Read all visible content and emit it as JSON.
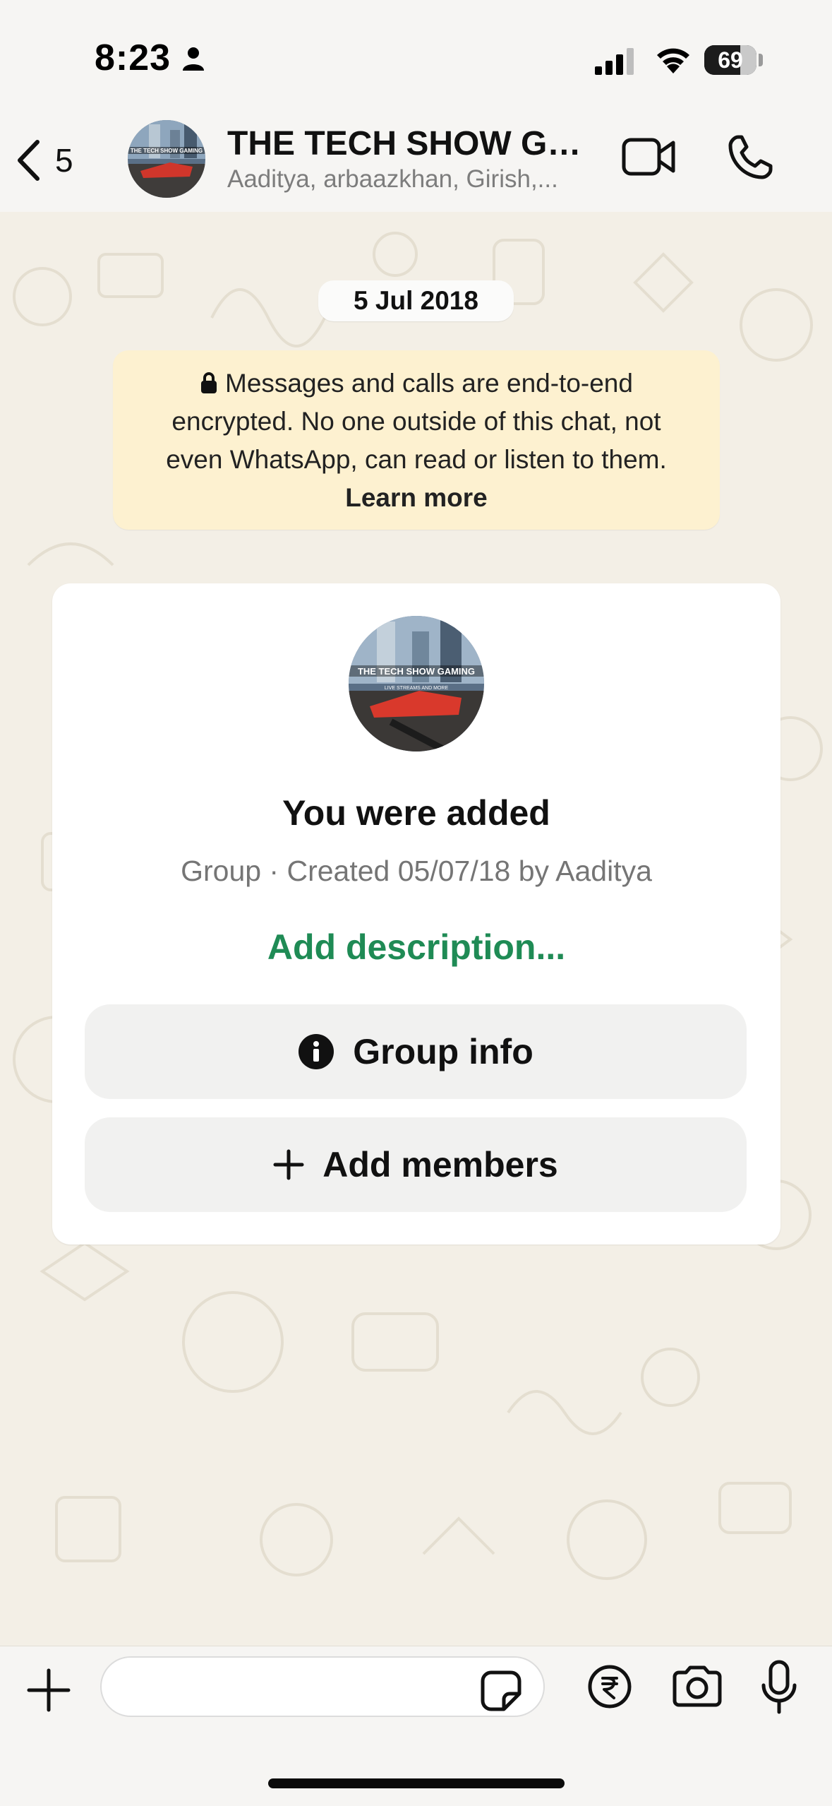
{
  "status_bar": {
    "time": "8:23",
    "battery_level": "69",
    "battery_fraction": 0.69
  },
  "header": {
    "back_count": "5",
    "group_name": "THE TECH SHOW GA...",
    "members": "Aaditya, arbaazkhan, Girish,...",
    "avatar_text": "THE TECH SHOW GAMING"
  },
  "chat": {
    "date_label": "5 Jul 2018",
    "encryption_notice": {
      "line1": "Messages and calls are end-to-end",
      "line2": "encrypted. No one outside of this chat, not",
      "line3": "even WhatsApp, can read or listen to them.",
      "learn_more": "Learn more"
    },
    "system_card": {
      "avatar_text": "THE TECH SHOW GAMING",
      "avatar_subtext": "LIVE STREAMS AND MORE",
      "title": "You were added",
      "subtitle": "Group · Created 05/07/18 by Aaditya",
      "add_description": "Add description...",
      "group_info_label": "Group info",
      "add_members_label": "Add members"
    }
  },
  "input_bar": {
    "placeholder": ""
  },
  "colors": {
    "accent_green": "#1f8b55",
    "notice_bg": "#fdf1d0",
    "wallpaper_bg": "#f3efe6"
  },
  "icons": [
    "person-icon",
    "signal-icon",
    "wifi-icon",
    "back-chevron-icon",
    "video-camera-icon",
    "phone-icon",
    "lock-icon",
    "info-icon",
    "plus-icon",
    "sticker-icon",
    "rupee-icon",
    "camera-icon",
    "microphone-icon"
  ]
}
